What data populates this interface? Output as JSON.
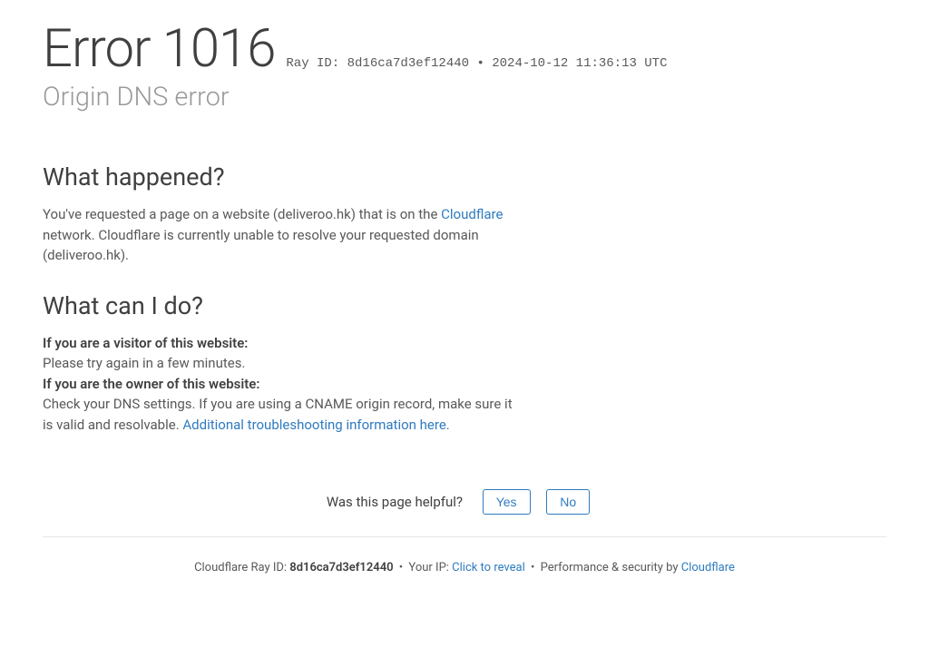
{
  "header": {
    "error_prefix": "Error",
    "error_code": "1016",
    "ray_label": "Ray ID:",
    "ray_id": "8d16ca7d3ef12440",
    "separator": "•",
    "timestamp": "2024-10-12 11:36:13 UTC",
    "subtitle": "Origin DNS error"
  },
  "what_happened": {
    "heading": "What happened?",
    "body_pre": "You've requested a page on a website (deliveroo.hk) that is on the ",
    "cloudflare_link": "Cloudflare",
    "body_post": " network. Cloudflare is currently unable to resolve your requested domain (deliveroo.hk)."
  },
  "what_can_i_do": {
    "heading": "What can I do?",
    "visitor_label": "If you are a visitor of this website:",
    "visitor_body": "Please try again in a few minutes.",
    "owner_label": "If you are the owner of this website:",
    "owner_body_pre": "Check your DNS settings. If you are using a CNAME origin record, make sure it is valid and resolvable. ",
    "troubleshooting_link": "Additional troubleshooting information here."
  },
  "feedback": {
    "question": "Was this page helpful?",
    "yes_label": "Yes",
    "no_label": "No"
  },
  "footer": {
    "ray_label": "Cloudflare Ray ID:",
    "ray_id": "8d16ca7d3ef12440",
    "ip_label": "Your IP:",
    "click_reveal": "Click to reveal",
    "perf_label": "Performance & security by",
    "cloudflare_link": "Cloudflare",
    "separator": "•"
  }
}
